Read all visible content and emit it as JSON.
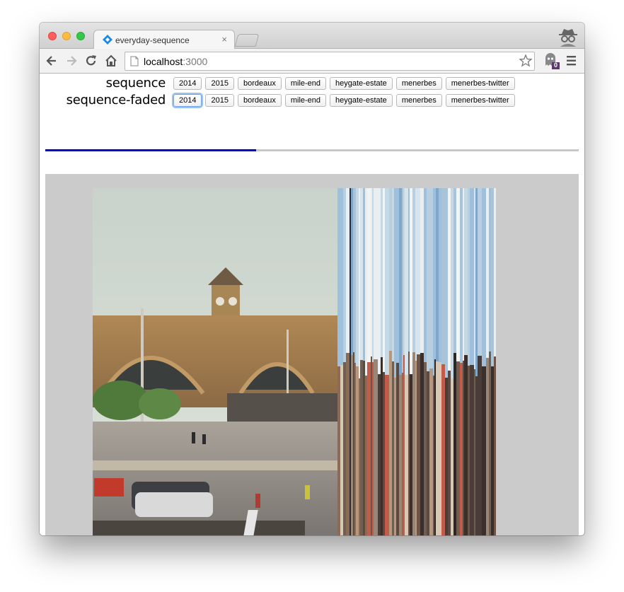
{
  "browser": {
    "tab_title": "everyday-sequence",
    "tab_close": "×",
    "url_host": "localhost",
    "url_port": ":3000",
    "extension_badge": "0",
    "icons": [
      "back-arrow-icon",
      "forward-arrow-icon",
      "reload-icon",
      "home-icon",
      "page-icon",
      "star-icon",
      "ghost-extension-icon",
      "menu-icon",
      "incognito-icon"
    ]
  },
  "page": {
    "rows": [
      {
        "label": "sequence",
        "buttons": [
          "2014",
          "2015",
          "bordeaux",
          "mile-end",
          "heygate-estate",
          "menerbes",
          "menerbes-twitter"
        ]
      },
      {
        "label": "sequence-faded",
        "buttons": [
          "2014",
          "2015",
          "bordeaux",
          "mile-end",
          "heygate-estate",
          "menerbes",
          "menerbes-twitter"
        ]
      }
    ],
    "focused_button": "sequence-faded 2014",
    "progress": 0.395,
    "colors": {
      "progress_fill": "#0000cc",
      "progress_track": "#c8c8c8",
      "viewer_bg": "#cbcbcb"
    }
  }
}
